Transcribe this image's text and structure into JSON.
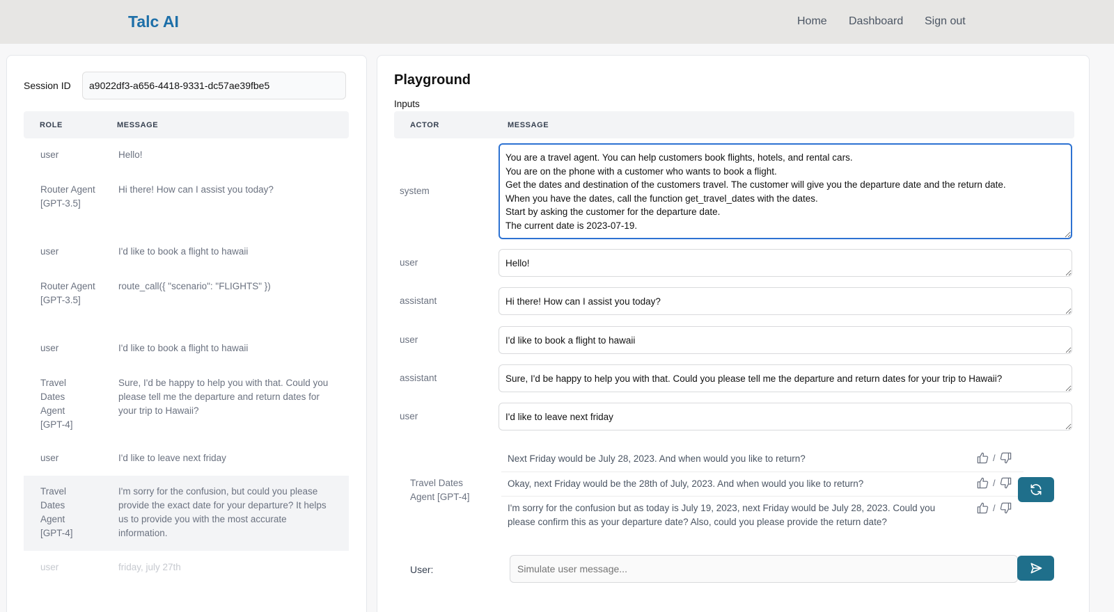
{
  "header": {
    "brand": "Talc AI",
    "nav": [
      "Home",
      "Dashboard",
      "Sign out"
    ]
  },
  "session": {
    "label": "Session ID",
    "value": "a9022df3-a656-4418-9331-dc57ae39fbe5"
  },
  "history": {
    "columns": [
      "ROLE",
      "MESSAGE"
    ],
    "rows": [
      {
        "role": "user",
        "message": "Hello!"
      },
      {
        "role": "Router Agent [GPT-3.5]",
        "message": "Hi there! How can I assist you today?"
      },
      {
        "role": "user",
        "message": "I'd like to book a flight to hawaii"
      },
      {
        "role": "Router Agent [GPT-3.5]",
        "message": "route_call({ \"scenario\": \"FLIGHTS\" })"
      },
      {
        "role": "user",
        "message": "I'd like to book a flight to hawaii"
      },
      {
        "role": "Travel Dates Agent [GPT-4]",
        "message": "Sure, I'd be happy to help you with that. Could you please tell me the departure and return dates for your trip to Hawaii?"
      },
      {
        "role": "user",
        "message": "I'd like to leave next friday"
      },
      {
        "role": "Travel Dates Agent [GPT-4]",
        "message": "I'm sorry for the confusion, but could you please provide the exact date for your departure? It helps us to provide you with the most accurate information."
      },
      {
        "role": "user",
        "message": "friday, july 27th"
      }
    ]
  },
  "playground": {
    "title": "Playground",
    "inputs_label": "Inputs",
    "columns": [
      "ACTOR",
      "MESSAGE"
    ],
    "inputs": [
      {
        "actor": "system",
        "message": "You are a travel agent. You can help customers book flights, hotels, and rental cars.\nYou are on the phone with a customer who wants to book a flight.\nGet the dates and destination of the customers travel. The customer will give you the departure date and the return date.\nWhen you have the dates, call the function get_travel_dates with the dates.\nStart by asking the customer for the departure date.\nThe current date is 2023-07-19."
      },
      {
        "actor": "user",
        "message": "Hello!"
      },
      {
        "actor": "assistant",
        "message": "Hi there! How can I assist you today?"
      },
      {
        "actor": "user",
        "message": "I'd like to book a flight to hawaii"
      },
      {
        "actor": "assistant",
        "message": "Sure, I'd be happy to help you with that. Could you please tell me the departure and return dates for your trip to Hawaii?"
      },
      {
        "actor": "user",
        "message": "I'd like to leave next friday"
      }
    ],
    "responses_agent": "Travel Dates Agent [GPT-4]",
    "responses": [
      "Next Friday would be July 28, 2023. And when would you like to return?",
      "Okay, next Friday would be the 28th of July, 2023. And when would you like to return?",
      "I'm sorry for the confusion but as today is July 19, 2023, next Friday would be July 28, 2023. Could you please confirm this as your departure date? Also, could you please provide the return date?"
    ],
    "feedback_separator": "/",
    "user_label": "User:",
    "user_placeholder": "Simulate user message...",
    "icons": {
      "regenerate": "refresh-icon",
      "send": "send-icon",
      "like": "thumbs-up-icon",
      "dislike": "thumbs-down-icon"
    },
    "accent": "#1f6f8b"
  }
}
